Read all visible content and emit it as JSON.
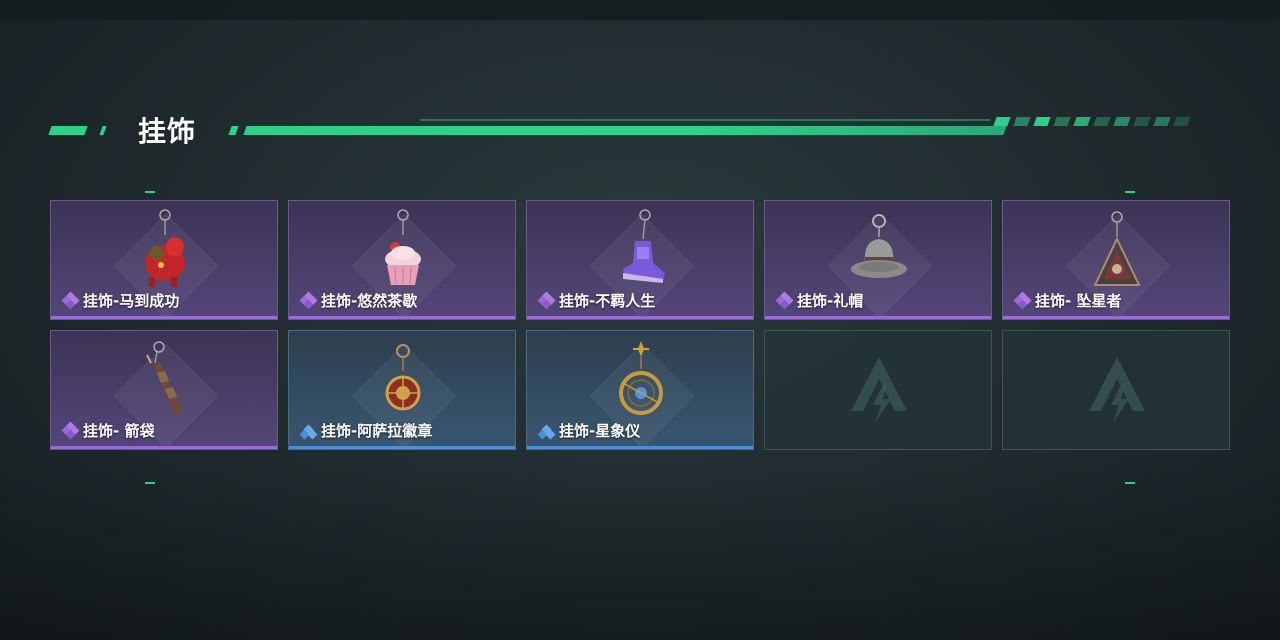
{
  "header": {
    "title": "挂饰"
  },
  "colors": {
    "accent": "#2fd08a",
    "epic": "#9a6ad8",
    "rare": "#4d8fd6"
  },
  "items": [
    {
      "label": "挂饰-马到成功",
      "rarity": "epic",
      "icon": "red-horse-charm-icon"
    },
    {
      "label": "挂饰-悠然茶歇",
      "rarity": "epic",
      "icon": "cupcake-charm-icon"
    },
    {
      "label": "挂饰-不羁人生",
      "rarity": "epic",
      "icon": "purple-sneaker-charm-icon"
    },
    {
      "label": "挂饰-礼帽",
      "rarity": "epic",
      "icon": "fedora-hat-charm-icon"
    },
    {
      "label": "挂饰- 坠星者",
      "rarity": "epic",
      "icon": "triangle-emblem-charm-icon"
    },
    {
      "label": "挂饰- 箭袋",
      "rarity": "epic",
      "icon": "quiver-charm-icon"
    },
    {
      "label": "挂饰-阿萨拉徽章",
      "rarity": "rare",
      "icon": "badge-medal-charm-icon"
    },
    {
      "label": "挂饰-星象仪",
      "rarity": "rare",
      "icon": "astrolabe-charm-icon"
    }
  ],
  "empty_slots": 2
}
